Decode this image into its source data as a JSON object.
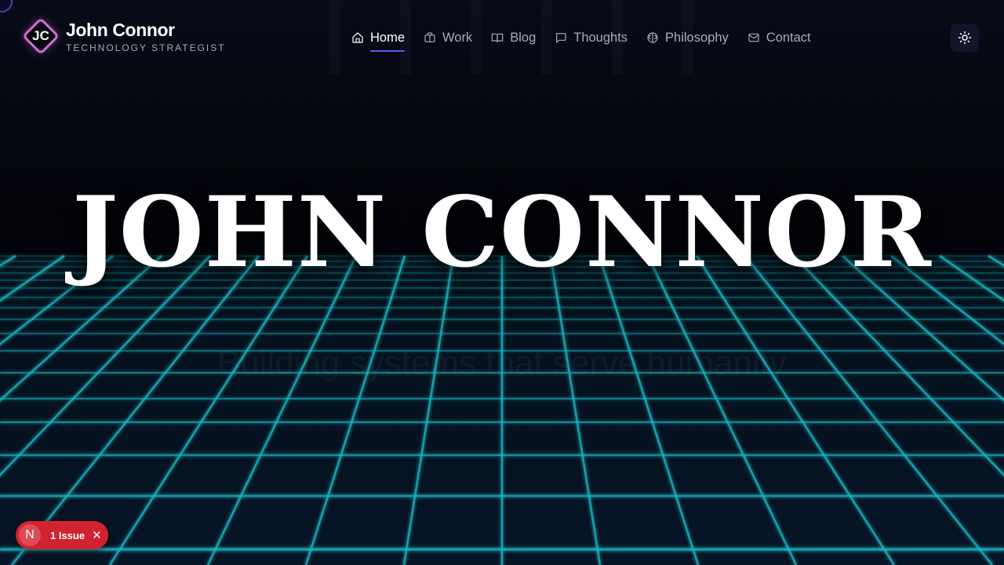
{
  "brand": {
    "initials": "JC",
    "name": "John Connor",
    "tagline": "TECHNOLOGY STRATEGIST",
    "logo_accent": "#d16bd6"
  },
  "nav": {
    "items": [
      {
        "label": "Home",
        "icon": "home-icon",
        "active": true
      },
      {
        "label": "Work",
        "icon": "briefcase-icon",
        "active": false
      },
      {
        "label": "Blog",
        "icon": "book-icon",
        "active": false
      },
      {
        "label": "Thoughts",
        "icon": "chat-bubble-icon",
        "active": false
      },
      {
        "label": "Philosophy",
        "icon": "brain-icon",
        "active": false
      },
      {
        "label": "Contact",
        "icon": "mail-icon",
        "active": false
      }
    ],
    "active_underline_color": "#5b5cf0"
  },
  "theme_toggle": {
    "icon": "sun-icon"
  },
  "hero": {
    "title": "JOHN CONNOR",
    "subtitle": "Building systems that serve humanity"
  },
  "grid_color": "#19b8c4",
  "issue_badge": {
    "logo": "N",
    "label": "1 Issue",
    "close_icon": "close-icon",
    "color": "#d1232f"
  }
}
